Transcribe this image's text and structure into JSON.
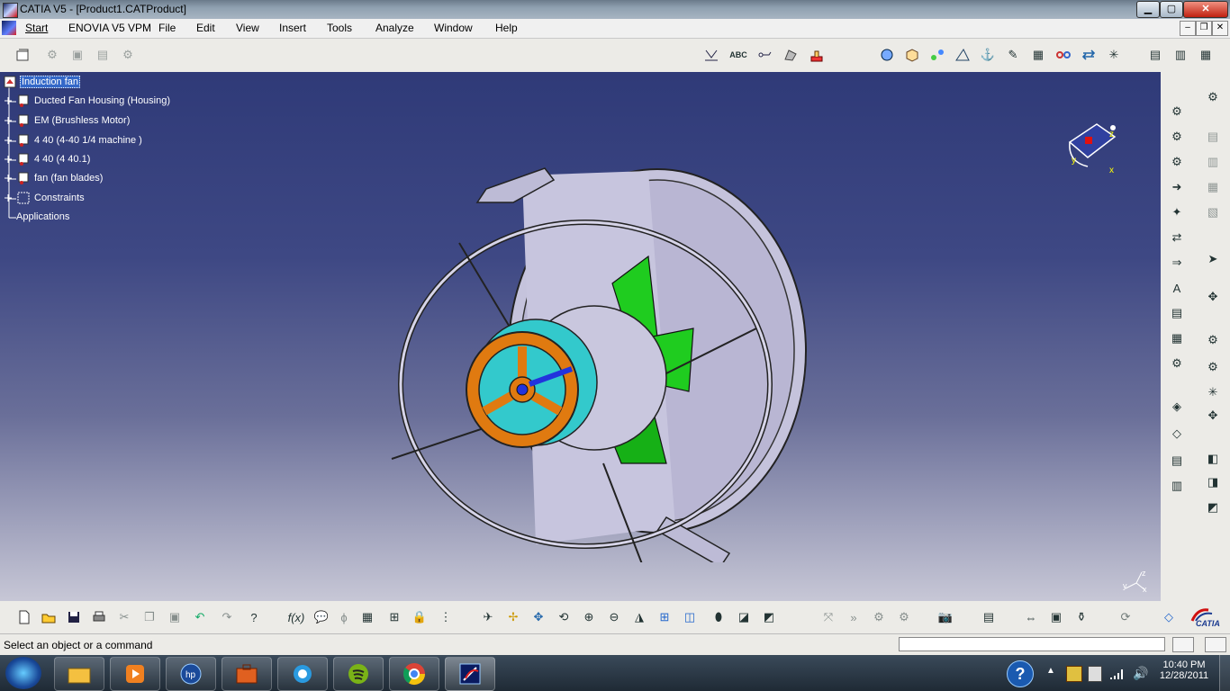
{
  "window": {
    "title": "CATIA V5 - [Product1.CATProduct]",
    "controls": {
      "minimize": "▁",
      "maximize": "▢",
      "close": "✕"
    },
    "mdi_controls": {
      "minimize": "–",
      "restore": "❐",
      "close": "✕"
    }
  },
  "menu": {
    "items": [
      "Start",
      "ENOVIA V5 VPM",
      "File",
      "Edit",
      "View",
      "Insert",
      "Tools",
      "Analyze",
      "Window",
      "Help"
    ]
  },
  "tree": {
    "root": "Induction fan",
    "children": [
      {
        "label": "Ducted Fan Housing (Housing)",
        "icon": "part-icon"
      },
      {
        "label": "EM (Brushless Motor)",
        "icon": "part-icon"
      },
      {
        "label": "4 40 (4-40 1/4 machine )",
        "icon": "part-icon"
      },
      {
        "label": "4 40 (4 40.1)",
        "icon": "part-icon"
      },
      {
        "label": "fan (fan blades)",
        "icon": "part-icon"
      },
      {
        "label": "Constraints",
        "icon": "constraints-icon"
      }
    ],
    "applications": "Applications"
  },
  "compass": {
    "x_label": "x",
    "y_label": "y",
    "z_label": "z"
  },
  "axis_triad": {
    "x": "x",
    "y": "y",
    "z": "z"
  },
  "status": {
    "message": "Select an object or a command",
    "command_input": ""
  },
  "brand": {
    "logo_text": "CATIA"
  },
  "taskbar": {
    "time": "10:40 PM",
    "date": "12/28/2011",
    "apps": [
      "explorer-icon",
      "media-player-icon",
      "hp-icon",
      "briefcase-icon",
      "ie-icon",
      "spotify-icon",
      "chrome-icon",
      "catia-icon"
    ]
  },
  "colors": {
    "viewport_top": "#2f3a78",
    "viewport_bottom": "#c7c7d6",
    "housing": "#c5c3dc",
    "hub_cyan": "#33c9cc",
    "motor_orange": "#e07a10",
    "blade_green": "#1fcc1f",
    "selection": "#3468c8"
  }
}
